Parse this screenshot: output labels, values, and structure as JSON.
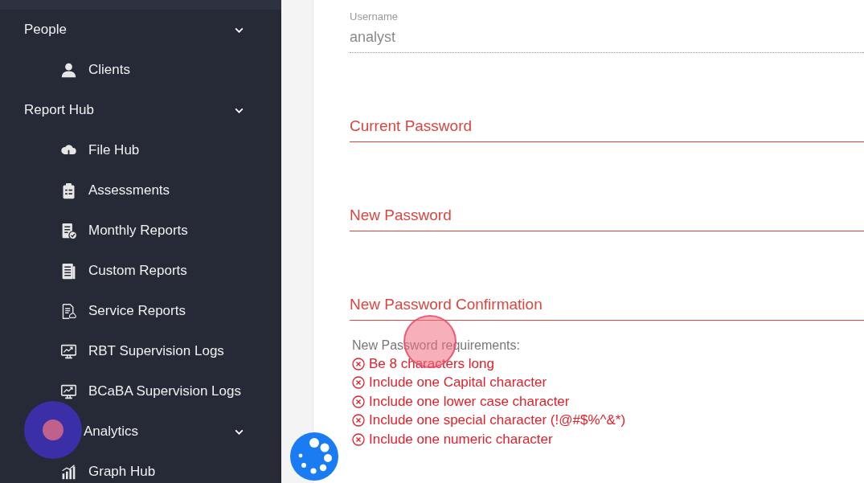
{
  "sidebar": {
    "groups": [
      {
        "label": "People",
        "expanded": true,
        "children": [
          {
            "label": "Clients",
            "kind": "person"
          }
        ]
      },
      {
        "label": "Report Hub",
        "expanded": true,
        "children": [
          {
            "label": "File Hub",
            "kind": "cloud"
          },
          {
            "label": "Assessments",
            "kind": "clipboard"
          },
          {
            "label": "Monthly Reports",
            "kind": "doccheck"
          },
          {
            "label": "Custom Reports",
            "kind": "doc"
          },
          {
            "label": "Service Reports",
            "kind": "doccloud"
          },
          {
            "label": "RBT Supervision Logs",
            "kind": "monitor"
          },
          {
            "label": "BCaBA Supervision Logs",
            "kind": "monitor"
          }
        ]
      },
      {
        "label": "Analytics",
        "kind": "indented",
        "expanded": true,
        "children": [
          {
            "label": "Graph Hub",
            "kind": "chart"
          }
        ]
      }
    ]
  },
  "form": {
    "fields": [
      {
        "label": "Username",
        "value": "analyst",
        "disabled": true,
        "error": false
      },
      {
        "label": "Current Password",
        "disabled": false,
        "error": true
      },
      {
        "label": "New Password",
        "disabled": false,
        "error": true
      },
      {
        "label": "New Password Confirmation",
        "disabled": false,
        "error": true
      }
    ],
    "requirements_title": "New Password requirements:",
    "requirements": [
      {
        "text": "Be 8 characters long",
        "met": false
      },
      {
        "text": "Include one Capital character",
        "met": false
      },
      {
        "text": "Include one lower case character",
        "met": false
      },
      {
        "text": "Include one special character (!@#$%^&*)",
        "met": false
      },
      {
        "text": "Include one numeric character",
        "met": false
      }
    ]
  }
}
